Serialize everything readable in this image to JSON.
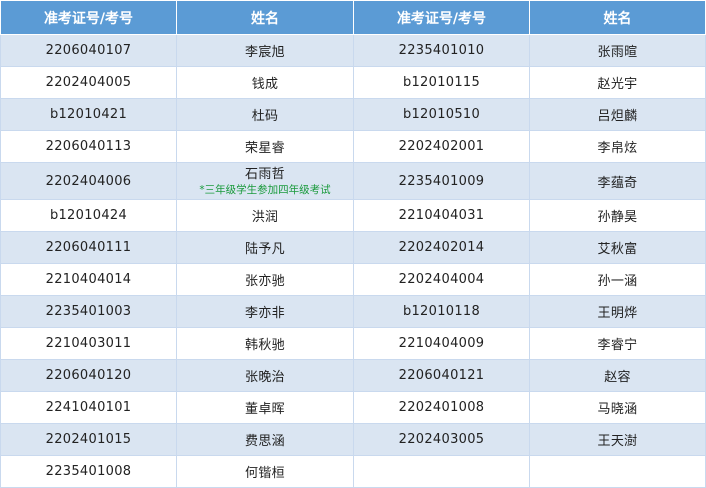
{
  "headers": [
    "准考证号/考号",
    "姓名",
    "准考证号/考号",
    "姓名"
  ],
  "rows": [
    {
      "id1": "2206040107",
      "name1": "李宸旭",
      "id2": "2235401010",
      "name2": "张雨暄"
    },
    {
      "id1": "2202404005",
      "name1": "钱成",
      "id2": "b12010115",
      "name2": "赵光宇"
    },
    {
      "id1": "b12010421",
      "name1": "杜码",
      "id2": "b12010510",
      "name2": "吕炟麟"
    },
    {
      "id1": "2206040113",
      "name1": "荣星睿",
      "id2": "2202402001",
      "name2": "李帛炫"
    },
    {
      "id1": "2202404006",
      "name1": "石雨哲",
      "note1": "*三年级学生参加四年级考试",
      "id2": "2235401009",
      "name2": "李蕴奇"
    },
    {
      "id1": "b12010424",
      "name1": "洪润",
      "id2": "2210404031",
      "name2": "孙静昊"
    },
    {
      "id1": "2206040111",
      "name1": "陆予凡",
      "id2": "2202402014",
      "name2": "艾秋富"
    },
    {
      "id1": "2210404014",
      "name1": "张亦驰",
      "id2": "2202404004",
      "name2": "孙一涵"
    },
    {
      "id1": "2235401003",
      "name1": "李亦非",
      "id2": "b12010118",
      "name2": "王明烨"
    },
    {
      "id1": "2210403011",
      "name1": "韩秋驰",
      "id2": "2210404009",
      "name2": "李睿宁"
    },
    {
      "id1": "2206040120",
      "name1": "张晚治",
      "id2": "2206040121",
      "name2": "赵容"
    },
    {
      "id1": "2241040101",
      "name1": "董卓晖",
      "id2": "2202401008",
      "name2": "马晓涵"
    },
    {
      "id1": "2202401015",
      "name1": "费思涵",
      "id2": "2202403005",
      "name2": "王天澍"
    },
    {
      "id1": "2235401008",
      "name1": "何锴桓",
      "id2": "",
      "name2": ""
    }
  ]
}
